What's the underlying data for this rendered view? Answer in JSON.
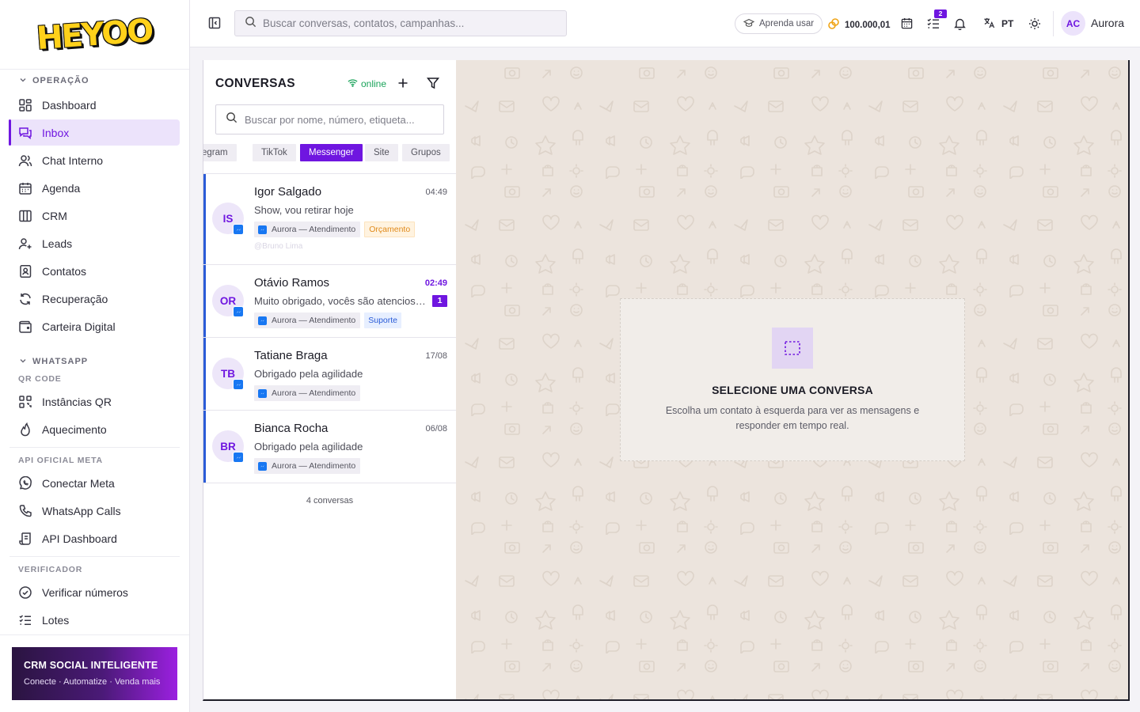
{
  "brand": {
    "logo_text": "HEYOO"
  },
  "sidebar": {
    "sections": {
      "operacao": "OPERAÇÃO",
      "whatsapp": "WHATSAPP",
      "qr_code": "QR CODE",
      "api_oficial": "API OFICIAL META",
      "verificador": "VERIFICADOR"
    },
    "items": [
      {
        "label": "Dashboard",
        "icon": "grid-icon"
      },
      {
        "label": "Inbox",
        "icon": "inbox-icon",
        "active": true
      },
      {
        "label": "Chat Interno",
        "icon": "users-icon"
      },
      {
        "label": "Agenda",
        "icon": "calendar-icon"
      },
      {
        "label": "CRM",
        "icon": "columns-icon"
      },
      {
        "label": "Leads",
        "icon": "user-plus-icon"
      },
      {
        "label": "Contatos",
        "icon": "contact-book-icon"
      },
      {
        "label": "Recuperação",
        "icon": "refresh-icon"
      },
      {
        "label": "Carteira Digital",
        "icon": "wallet-icon"
      },
      {
        "label": "Instâncias QR",
        "icon": "qr-icon"
      },
      {
        "label": "Aquecimento",
        "icon": "flame-icon"
      },
      {
        "label": "Conectar Meta",
        "icon": "whatsapp-icon"
      },
      {
        "label": "WhatsApp Calls",
        "icon": "phone-icon"
      },
      {
        "label": "API Dashboard",
        "icon": "scroll-icon"
      },
      {
        "label": "Verificar números",
        "icon": "check-circle-icon"
      },
      {
        "label": "Lotes",
        "icon": "list-check-icon"
      }
    ],
    "promo": {
      "title": "CRM SOCIAL INTELIGENTE",
      "subtitle": "Conecte · Automatize · Venda mais"
    }
  },
  "topbar": {
    "search_placeholder": "Buscar conversas, contatos, campanhas...",
    "learn_label": "Aprenda usar",
    "credits": "100.000,01",
    "tasks_badge": "2",
    "language": "PT",
    "user_initials": "AC",
    "user_name": "Aurora"
  },
  "conversations": {
    "title": "CONVERSAS",
    "status": "online",
    "search_placeholder": "Buscar por nome, número, etiqueta...",
    "channels": [
      "egram",
      "TikTok",
      "Messenger",
      "Site",
      "Grupos"
    ],
    "active_channel": "Messenger",
    "items": [
      {
        "initials": "IS",
        "name": "Igor Salgado",
        "time": "04:49",
        "message": "Show, vou retirar hoje",
        "instance": "Aurora — Atendimento",
        "tag": "Orçamento",
        "assigned": "@Bruno Lima"
      },
      {
        "initials": "OR",
        "name": "Otávio Ramos",
        "time": "02:49",
        "message": "Muito obrigado, vocês são atenciosos...",
        "unread": "1",
        "instance": "Aurora — Atendimento",
        "tag": "Suporte"
      },
      {
        "initials": "TB",
        "name": "Tatiane Braga",
        "time": "17/08",
        "message": "Obrigado pela agilidade",
        "instance": "Aurora — Atendimento"
      },
      {
        "initials": "BR",
        "name": "Bianca Rocha",
        "time": "06/08",
        "message": "Obrigado pela agilidade",
        "instance": "Aurora — Atendimento"
      }
    ],
    "count_label": "4 conversas"
  },
  "chat": {
    "empty_title": "SELECIONE UMA CONVERSA",
    "empty_subtitle": "Escolha um contato à esquerda para ver as mensagens e responder em tempo real."
  },
  "colors": {
    "accent": "#6f16e0",
    "messenger": "#1877f2",
    "online": "#1aa35a",
    "chat_bg": "#ece4dd"
  }
}
